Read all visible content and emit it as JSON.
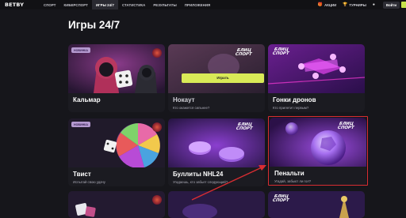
{
  "header": {
    "logo": "BETBY",
    "nav": [
      {
        "label": "СПОРТ",
        "active": false
      },
      {
        "label": "КИБЕРСПОРТ",
        "active": false
      },
      {
        "label": "ИГРЫ 24/7",
        "active": true
      },
      {
        "label": "СТАТИСТИКА",
        "active": false
      },
      {
        "label": "РЕЗУЛЬТАТЫ",
        "active": false
      },
      {
        "label": "ПРИЛОЖЕНИЯ",
        "active": false
      }
    ],
    "promo_label": "АКЦИИ",
    "tournaments_label": "ТУРНИРЫ",
    "login_label": "Войти"
  },
  "page_title": "Игры 24/7",
  "blitz_label": "БЛИЦ\nСПОРТ",
  "cards": [
    {
      "title": "Кальмар",
      "subtitle": "",
      "badge": "НОВИНКА"
    },
    {
      "title": "Нокаут",
      "subtitle": "Кто окажется сильнее?",
      "play_label": "Играть"
    },
    {
      "title": "Гонки дронов",
      "subtitle": "Кто прилетит первым?"
    },
    {
      "title": "Твист",
      "subtitle": "Испытай свою удачу",
      "badge": "НОВИНКА"
    },
    {
      "title": "Буллиты NHL24",
      "subtitle": "Угадаешь, кто забьет следующий?"
    },
    {
      "title": "Пенальти",
      "subtitle": "Угадай, забьют ли гол?"
    }
  ],
  "colors": {
    "background": "#16161b",
    "accent_yellow": "#d9ea57",
    "highlight_red": "#d82d32",
    "badge": "#b59ad0"
  },
  "icons": [
    "gift-icon",
    "trophy-icon",
    "user-icon"
  ]
}
